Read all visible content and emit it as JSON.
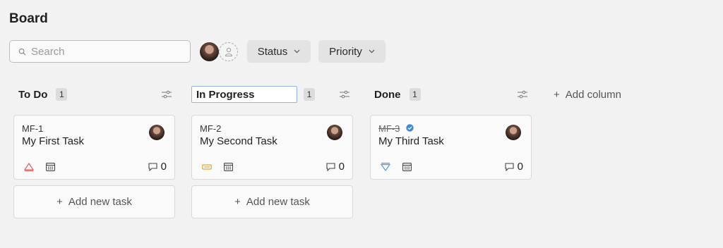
{
  "page": {
    "title": "Board"
  },
  "search": {
    "placeholder": "Search",
    "value": ""
  },
  "filters": {
    "status_label": "Status",
    "priority_label": "Priority"
  },
  "add_column_label": "Add column",
  "add_task_label": "Add new task",
  "colors": {
    "priority_high": "#e0605f",
    "priority_medium": "#e5a33a",
    "priority_low": "#5a97e0",
    "verified": "#3b8bd0"
  },
  "columns": [
    {
      "title": "To Do",
      "count": "1",
      "cards": [
        {
          "id": "MF-1",
          "title": "My First Task",
          "priority_icon": "priority-high-icon",
          "comments": "0",
          "done": false
        }
      ]
    },
    {
      "title": "In Progress",
      "count": "1",
      "editing": true,
      "cards": [
        {
          "id": "MF-2",
          "title": "My Second Task",
          "priority_icon": "priority-medium-icon",
          "comments": "0",
          "done": false
        }
      ]
    },
    {
      "title": "Done",
      "count": "1",
      "cards": [
        {
          "id": "MF-3",
          "title": "My Third Task",
          "priority_icon": "priority-low-icon",
          "comments": "0",
          "done": true
        }
      ]
    }
  ]
}
